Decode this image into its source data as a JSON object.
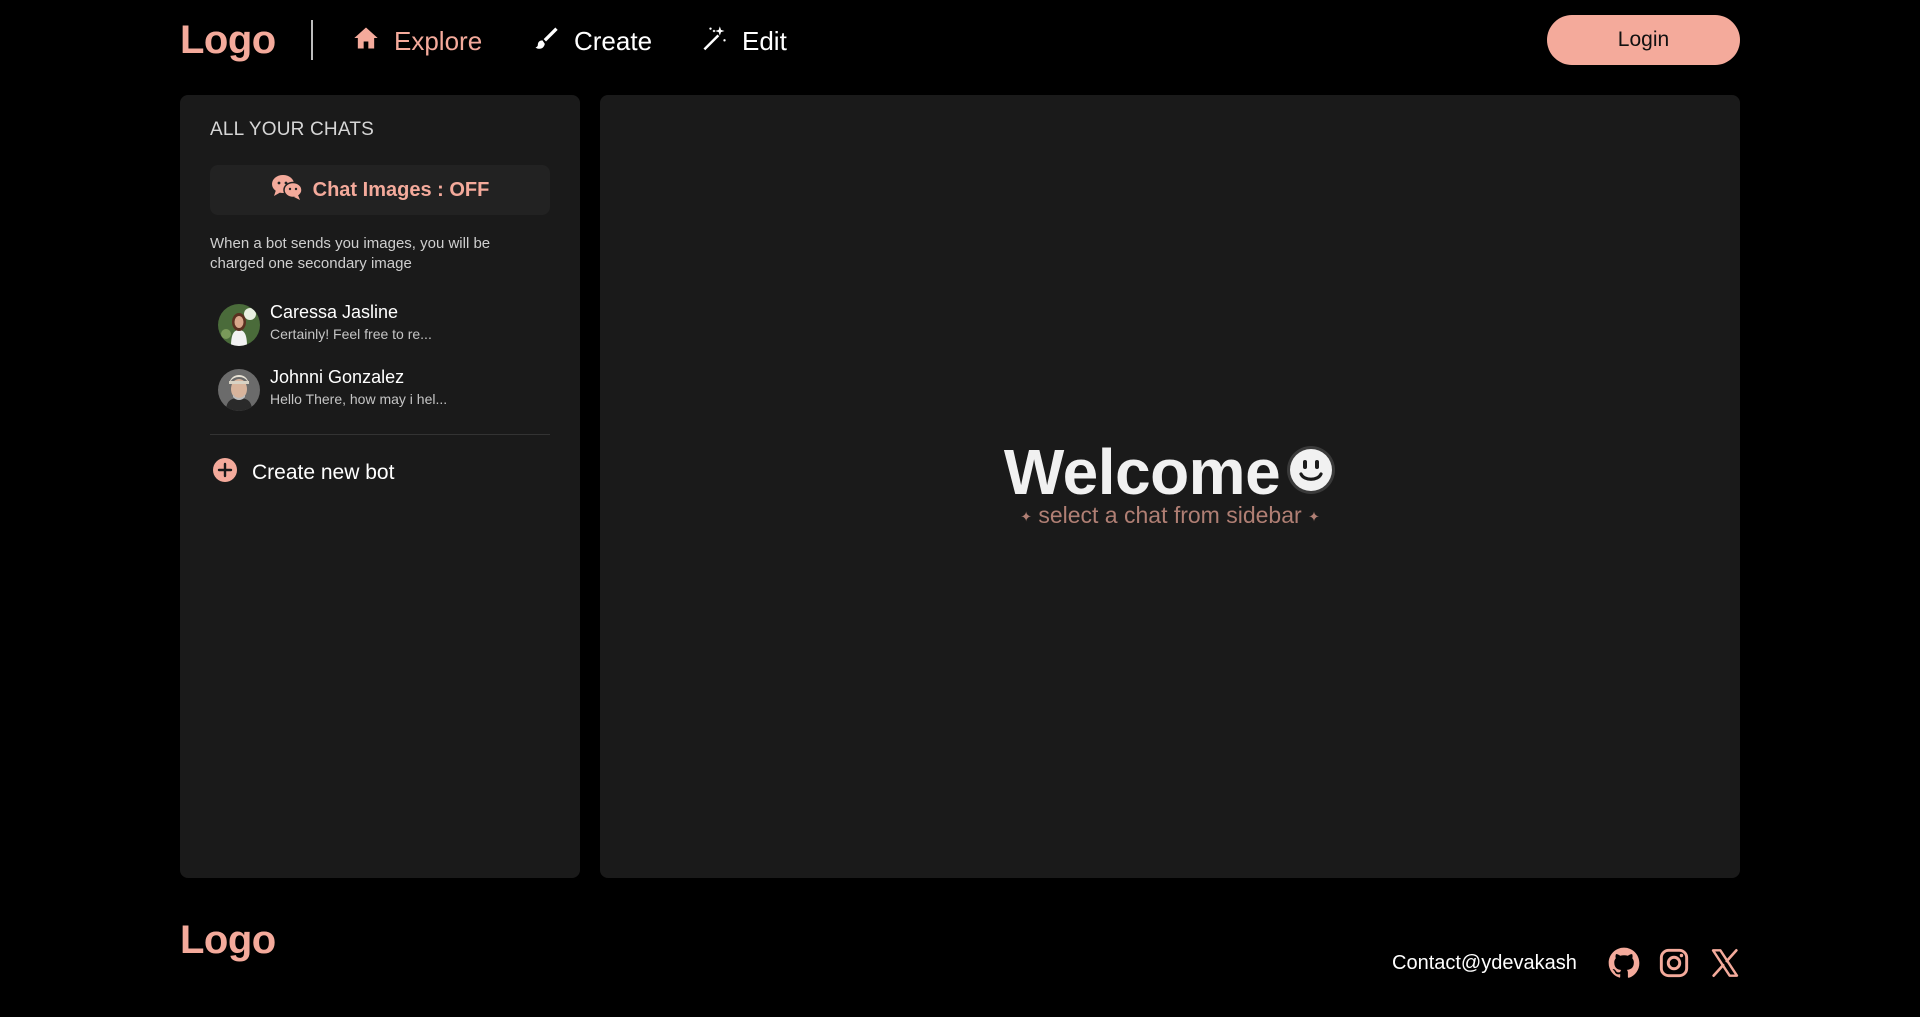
{
  "header": {
    "logo": "Logo",
    "nav": [
      {
        "label": "Explore",
        "icon": "home-icon",
        "active": true
      },
      {
        "label": "Create",
        "icon": "brush-icon",
        "active": false
      },
      {
        "label": "Edit",
        "icon": "magic-wand-icon",
        "active": false
      }
    ],
    "login_label": "Login"
  },
  "sidebar": {
    "title": "ALL YOUR CHATS",
    "toggle_label": "Chat Images : OFF",
    "hint": "When a bot sends you images, you will be charged one secondary image",
    "chats": [
      {
        "name": "Caressa Jasline",
        "preview": "Certainly! Feel free to re..."
      },
      {
        "name": "Johnni Gonzalez",
        "preview": "Hello There, how may i hel..."
      }
    ],
    "create_label": "Create new bot"
  },
  "main": {
    "welcome": "Welcome",
    "subtitle": "select a chat from sidebar"
  },
  "footer": {
    "logo": "Logo",
    "contact": "Contact@ydevakash"
  },
  "colors": {
    "accent": "#f4aa9b",
    "panel": "#1a1a1a",
    "background": "#000000",
    "subtitle": "#b07f74"
  }
}
